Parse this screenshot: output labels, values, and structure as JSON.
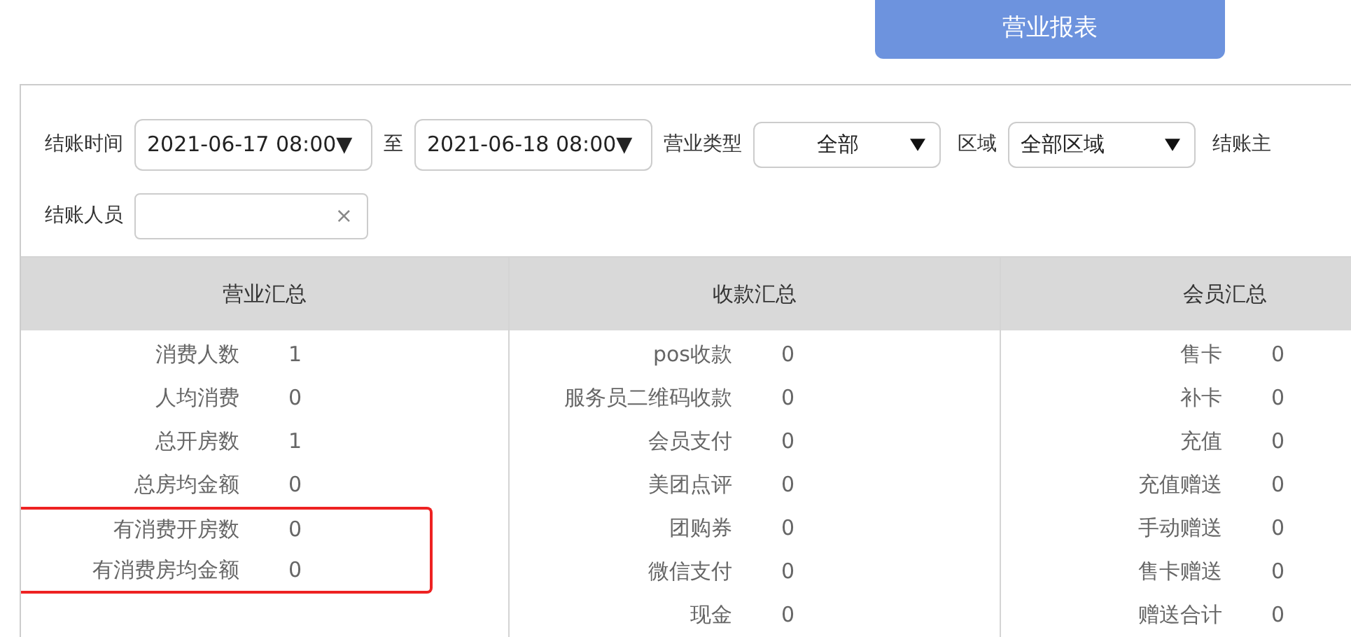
{
  "report_button": "营业报表",
  "filters": [
    {
      "kind": "select",
      "label": "结账时间",
      "value": "2021-06-17 08:00▼"
    },
    {
      "kind": "select",
      "label": "至",
      "value": "2021-06-18 08:00▼"
    },
    {
      "kind": "dropdown",
      "label": "营业类型",
      "value": "全部"
    },
    {
      "kind": "combo",
      "label": "区域",
      "value": "全部区域"
    },
    {
      "kind": "label",
      "label": "结账主"
    },
    {
      "kind": "clearable",
      "label": "结账人员",
      "clear": "×"
    }
  ],
  "columns": [
    {
      "title": "营业汇总",
      "rows": [
        {
          "label": "消费人数",
          "value": "1",
          "highlighted": false
        },
        {
          "label": "人均消费",
          "value": "0",
          "highlighted": false
        },
        {
          "label": "总开房数",
          "value": "1",
          "highlighted": false
        },
        {
          "label": "总房均金额",
          "value": "0",
          "highlighted": false
        },
        {
          "label": "有消费开房数",
          "value": "0",
          "highlighted": true
        },
        {
          "label": "有消费房均金额",
          "value": "0",
          "highlighted": true
        }
      ]
    },
    {
      "title": "收款汇总",
      "rows": [
        {
          "label": "pos收款",
          "value": "0",
          "highlighted": false
        },
        {
          "label": "服务员二维码收款",
          "value": "0",
          "highlighted": false
        },
        {
          "label": "会员支付",
          "value": "0",
          "highlighted": false
        },
        {
          "label": "美团点评",
          "value": "0",
          "highlighted": false
        },
        {
          "label": "团购券",
          "value": "0",
          "highlighted": false
        },
        {
          "label": "微信支付",
          "value": "0",
          "highlighted": false
        },
        {
          "label": "现金",
          "value": "0",
          "highlighted": false
        }
      ]
    },
    {
      "title": "会员汇总",
      "rows": [
        {
          "label": "售卡",
          "value": "0",
          "highlighted": false
        },
        {
          "label": "补卡",
          "value": "0",
          "highlighted": false
        },
        {
          "label": "充值",
          "value": "0",
          "highlighted": false
        },
        {
          "label": "充值赠送",
          "value": "0",
          "highlighted": false
        },
        {
          "label": "手动赠送",
          "value": "0",
          "highlighted": false
        },
        {
          "label": "售卡赠送",
          "value": "0",
          "highlighted": false
        },
        {
          "label": "赠送合计",
          "value": "0",
          "highlighted": false
        }
      ]
    }
  ]
}
